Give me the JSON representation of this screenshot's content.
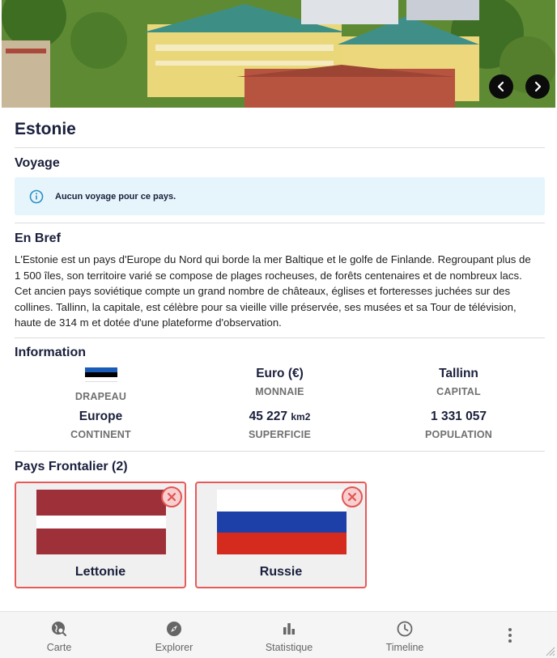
{
  "hero": {
    "prev_icon": "chevron-left-icon",
    "next_icon": "chevron-right-icon"
  },
  "country": {
    "name": "Estonie"
  },
  "voyage": {
    "title": "Voyage",
    "alert_text": "Aucun voyage pour ce pays.",
    "alert_icon": "info-icon"
  },
  "bref": {
    "title": "En Bref",
    "text": "L'Estonie est un pays d'Europe du Nord qui borde la mer Baltique et le golfe de Finlande. Regroupant plus de 1 500 îles, son territoire varié se compose de plages rocheuses, de forêts centenaires et de nombreux lacs. Cet ancien pays soviétique compte un grand nombre de châteaux, églises et forteresses juchées sur des collines. Tallinn, la capitale, est célèbre pour sa vieille ville préservée, ses musées et sa Tour de télévision, haute de 314 m et dotée d'une plateforme d'observation."
  },
  "information": {
    "title": "Information",
    "flag_label": "DRAPEAU",
    "flag_colors": [
      "#1a5bb8",
      "#000000",
      "#ffffff"
    ],
    "currency_value": "Euro (€)",
    "currency_label": "MONNAIE",
    "capital_value": "Tallinn",
    "capital_label": "CAPITAL",
    "continent_value": "Europe",
    "continent_label": "CONTINENT",
    "area_value": "45 227",
    "area_unit": "km2",
    "area_label": "SUPERFICIE",
    "population_value": "1 331 057",
    "population_label": "POPULATION"
  },
  "frontiers": {
    "title": "Pays Frontalier (2)",
    "items": [
      {
        "name": "Lettonie",
        "flag_colors": [
          "#9e3039",
          "#ffffff",
          "#9e3039"
        ]
      },
      {
        "name": "Russie",
        "flag_colors": [
          "#ffffff",
          "#1c3fa8",
          "#d52b1e"
        ]
      }
    ],
    "remove_icon": "close-circle-icon",
    "accent_color": "#e85a5a"
  },
  "nav": {
    "items": [
      {
        "label": "Carte",
        "icon": "globe-search-icon"
      },
      {
        "label": "Explorer",
        "icon": "compass-icon"
      },
      {
        "label": "Statistique",
        "icon": "bar-chart-icon"
      },
      {
        "label": "Timeline",
        "icon": "clock-icon"
      }
    ],
    "more_icon": "more-vertical-icon"
  }
}
